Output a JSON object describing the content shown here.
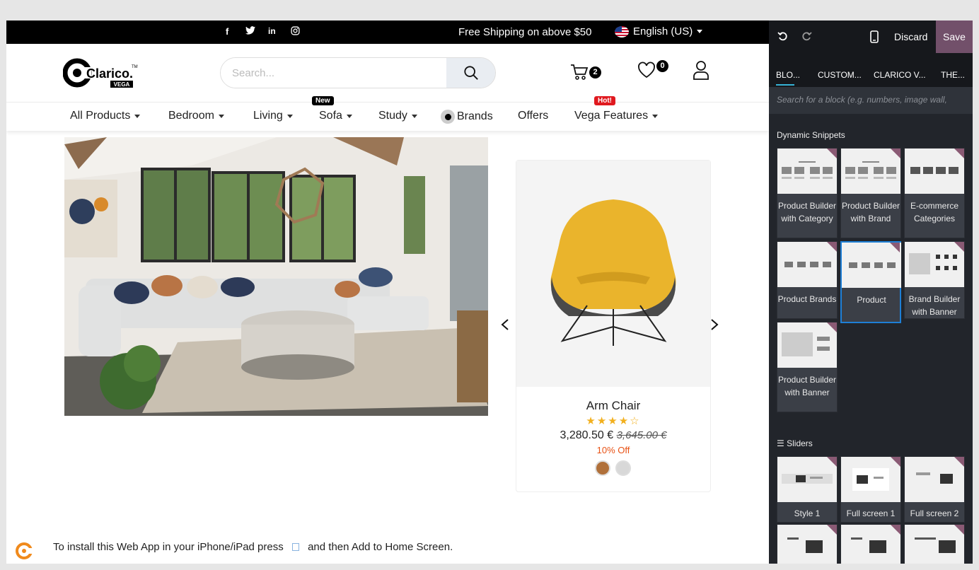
{
  "topbar": {
    "social": [
      "f",
      "t",
      "in",
      "ig"
    ],
    "shipping": "Free Shipping on above $50",
    "language": "English (US)"
  },
  "header": {
    "logo_text": "Clarico.",
    "logo_sub": "VEGA",
    "logo_tm": "TM",
    "search_placeholder": "Search...",
    "cart_count": "2",
    "wishlist_count": "0"
  },
  "nav": {
    "items": [
      "All Products",
      "Bedroom",
      "Living",
      "Sofa",
      "Study",
      "Brands",
      "Offers",
      "Vega Features"
    ],
    "new_tag": "New",
    "hot_tag": "Hot!"
  },
  "product": {
    "name": "Arm Chair",
    "rating": 4,
    "rating_max": 5,
    "price": "3,280.50 €",
    "old_price": "3,645.00 €",
    "discount": "10% Off",
    "swatches": [
      "#b0703a",
      "#d8d8d8"
    ]
  },
  "install": {
    "text_before": "To install this Web App in your iPhone/iPad press",
    "text_after": "and then Add to Home Screen."
  },
  "editor": {
    "discard": "Discard",
    "save": "Save",
    "tabs": [
      "BLO...",
      "CUSTOM...",
      "CLARICO V...",
      "THE..."
    ],
    "search_placeholder": "Search for a block (e.g. numbers, image wall,",
    "dynamic_title": "Dynamic Snippets",
    "dynamic_blocks": [
      "Product Builder with Category",
      "Product Builder with Brand",
      "E-commerce Categories",
      "Product Brands",
      "Product",
      "Brand Builder with Banner",
      "Product Builder with Banner"
    ],
    "sliders_title": "Sliders",
    "slider_blocks": [
      "Style 1",
      "Full screen 1",
      "Full screen 2"
    ]
  },
  "colors": {
    "accent": "#72506a",
    "topbar": "#000000",
    "panel": "#22252b",
    "star": "#f2b01e",
    "discount": "#e85215"
  }
}
